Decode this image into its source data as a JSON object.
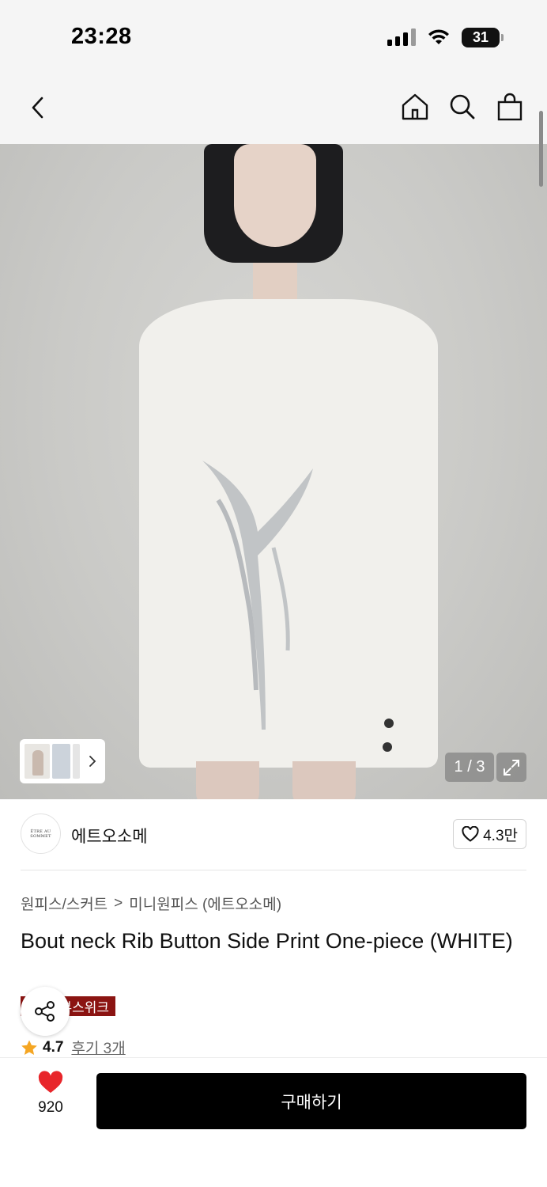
{
  "status_bar": {
    "time": "23:28",
    "battery": "31"
  },
  "product_image": {
    "page_counter": "1 / 3"
  },
  "brand": {
    "logo_text": "ÊTRE AU SOMMET",
    "name": "에트오소메",
    "likes": "4.3만"
  },
  "breadcrumb": {
    "category": "원피스/스커트",
    "separator": ">",
    "subcategory": "미니원피스 (에트오소메)"
  },
  "product": {
    "title": "Bout neck Rib Button Side Print One-piece (WHITE)",
    "promo_badge": "뷰스위크",
    "rating": "4.7",
    "reviews": "후기 3개"
  },
  "bottom_bar": {
    "wish_count": "920",
    "buy_label": "구매하기"
  },
  "colors": {
    "promo": "#8b1412",
    "heart": "#e8262b",
    "star": "#f5a623",
    "buy_button": "#000000"
  }
}
